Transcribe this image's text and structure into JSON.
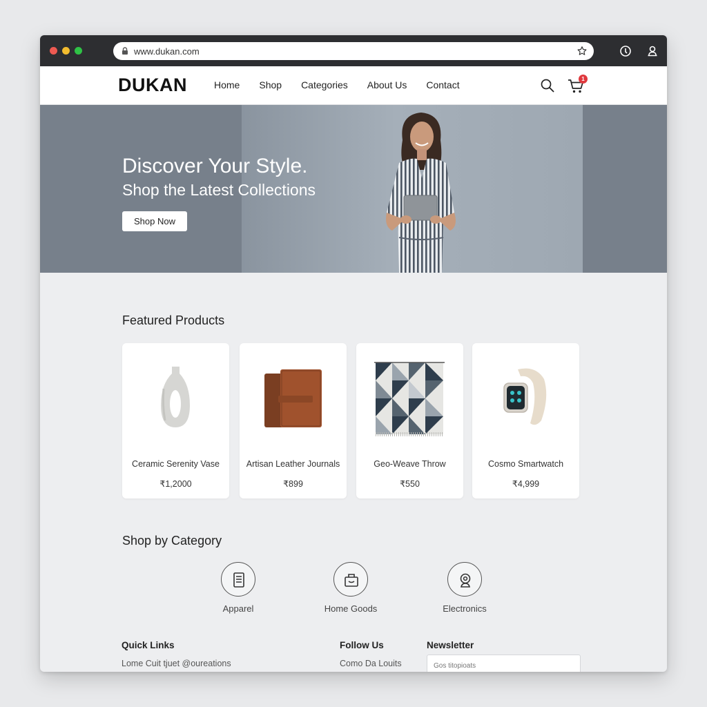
{
  "browser": {
    "url": "www.dukan.com"
  },
  "site": {
    "logo": "DUKAN",
    "nav": [
      "Home",
      "Shop",
      "Categories",
      "About Us",
      "Contact"
    ],
    "cart_count": "1"
  },
  "hero": {
    "title": "Discover Your Style.",
    "subtitle": "Shop the Latest Collections",
    "cta": "Shop Now"
  },
  "featured": {
    "title": "Featured Products",
    "products": [
      {
        "name": "Ceramic Serenity Vase",
        "price": "₹1,2000"
      },
      {
        "name": "Artisan Leather Journals",
        "price": "₹899"
      },
      {
        "name": "Geo-Weave Throw",
        "price": "₹550"
      },
      {
        "name": "Cosmo Smartwatch",
        "price": "₹4,999"
      }
    ]
  },
  "categories": {
    "title": "Shop by Category",
    "items": [
      {
        "label": "Apparel",
        "icon": "document-icon"
      },
      {
        "label": "Home Goods",
        "icon": "box-icon"
      },
      {
        "label": "Electronics",
        "icon": "webcam-icon"
      }
    ]
  },
  "footer": {
    "quick_links": {
      "heading": "Quick Links",
      "text": "Lome Cuit tjuet @oureations"
    },
    "follow_us": {
      "heading": "Follow Us",
      "text": "Como Da Louits"
    },
    "newsletter": {
      "heading": "Newsletter",
      "placeholder": "Gos titopioats"
    }
  }
}
